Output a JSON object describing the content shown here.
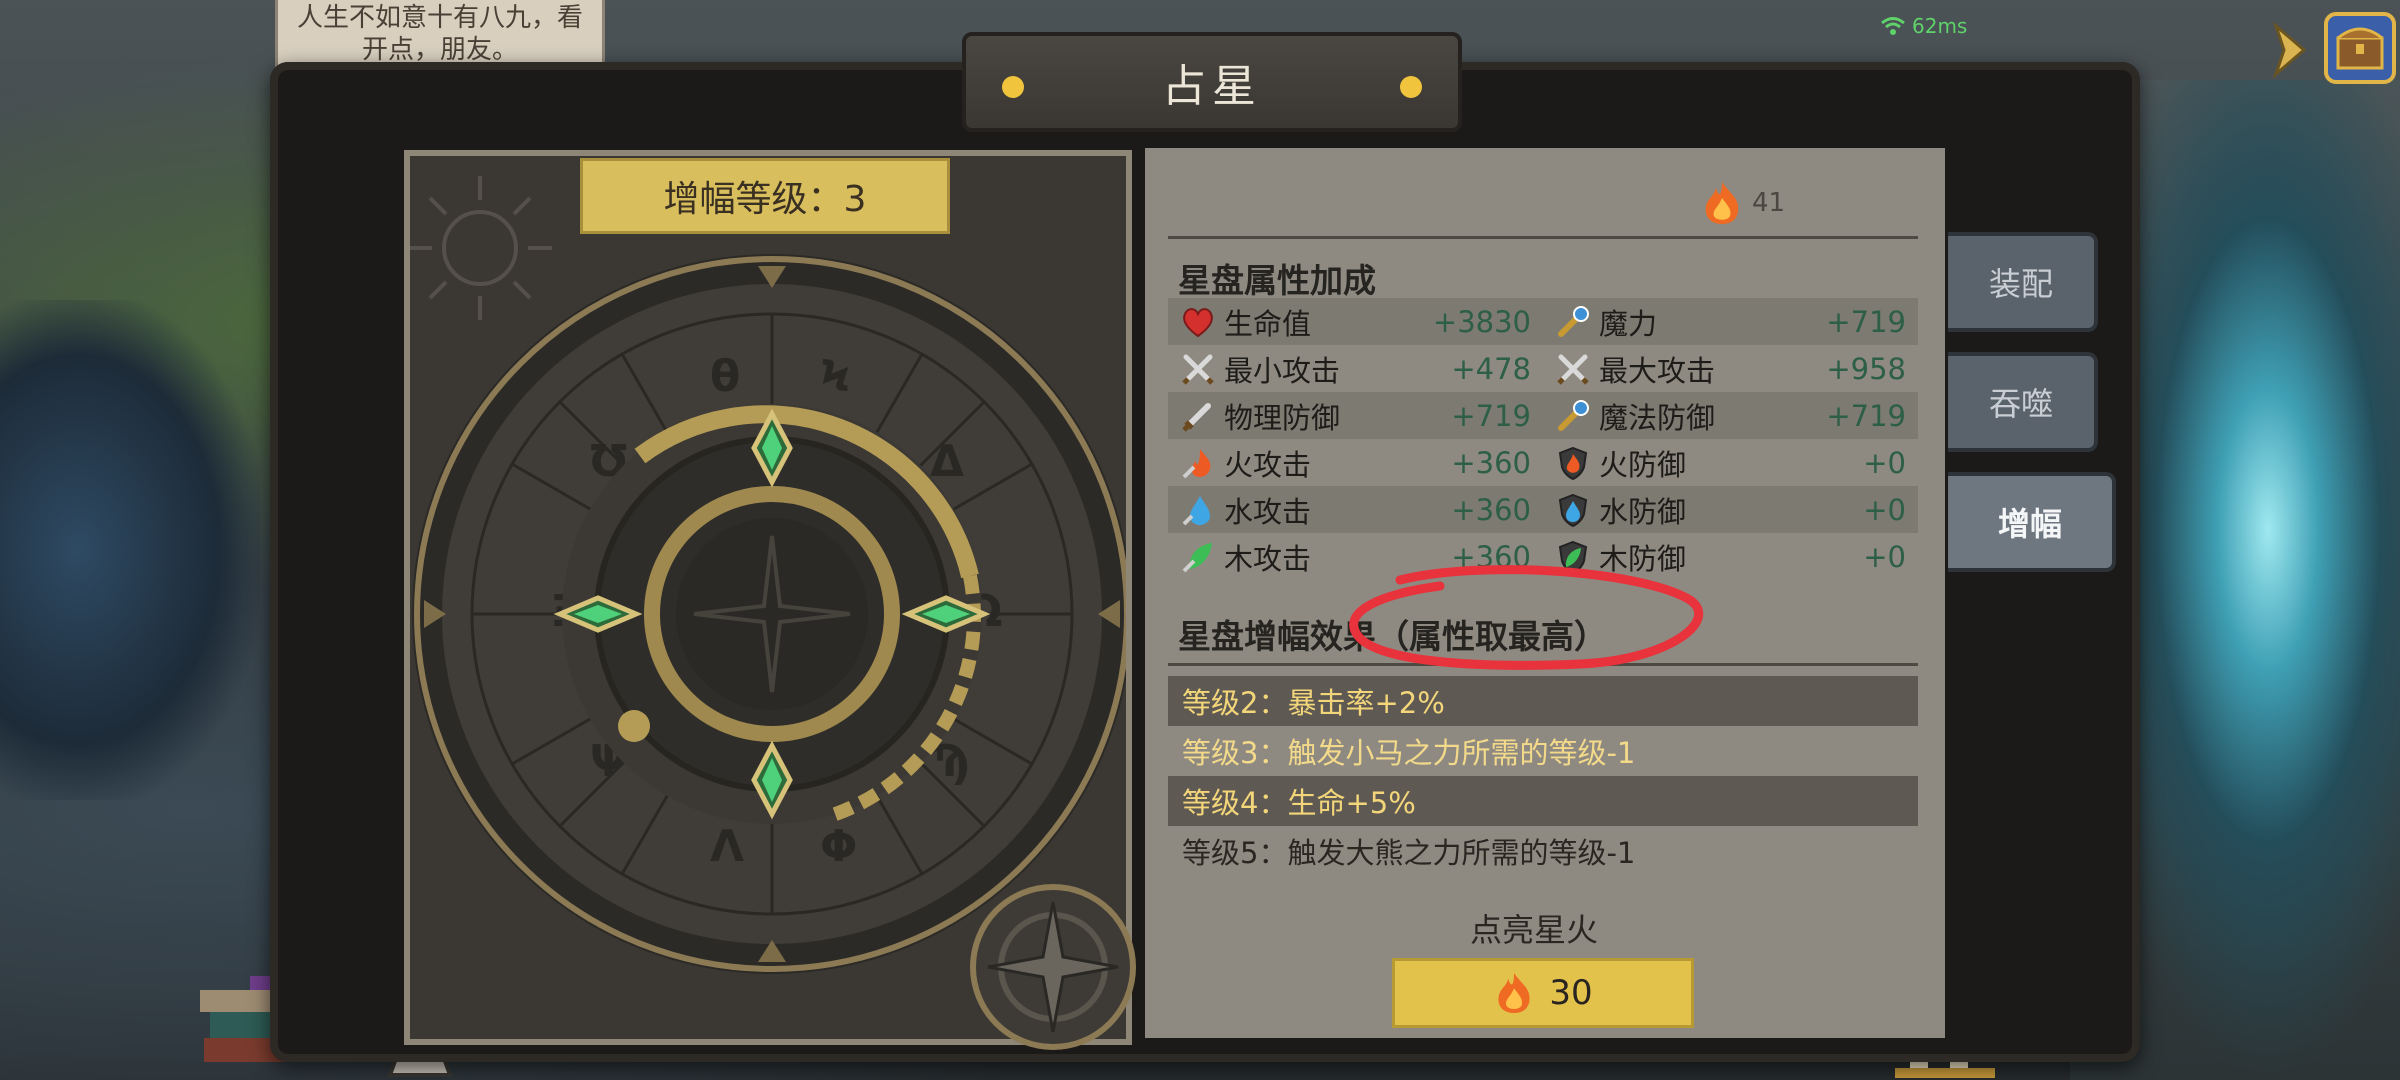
{
  "background": {
    "quote_line1": "人生不如意十有八九，看",
    "quote_line2": "开点，朋友。",
    "ping": "62ms"
  },
  "title": "占星",
  "dial": {
    "level_label": "增幅等级：3"
  },
  "flame_currency": {
    "icon": "flame-icon",
    "count": "41"
  },
  "attributes": {
    "title": "星盘属性加成",
    "rows": [
      [
        {
          "icon": "heart-icon",
          "name": "生命值",
          "value": "+3830"
        },
        {
          "icon": "wand-icon",
          "name": "魔力",
          "value": "+719"
        }
      ],
      [
        {
          "icon": "crossed-swords-icon",
          "name": "最小攻击",
          "value": "+478"
        },
        {
          "icon": "crossed-swords-icon",
          "name": "最大攻击",
          "value": "+958"
        }
      ],
      [
        {
          "icon": "sword-icon",
          "name": "物理防御",
          "value": "+719"
        },
        {
          "icon": "wand-icon",
          "name": "魔法防御",
          "value": "+719"
        }
      ],
      [
        {
          "icon": "fire-attack-icon",
          "name": "火攻击",
          "value": "+360"
        },
        {
          "icon": "fire-shield-icon",
          "name": "火防御",
          "value": "+0"
        }
      ],
      [
        {
          "icon": "water-attack-icon",
          "name": "水攻击",
          "value": "+360"
        },
        {
          "icon": "water-shield-icon",
          "name": "水防御",
          "value": "+0"
        }
      ],
      [
        {
          "icon": "wood-attack-icon",
          "name": "木攻击",
          "value": "+360"
        },
        {
          "icon": "wood-shield-icon",
          "name": "木防御",
          "value": "+0"
        }
      ]
    ]
  },
  "amplify_effects": {
    "title": "星盘增幅效果（属性取最高）",
    "items": [
      "等级2：暴击率+2%",
      "等级3：触发小马之力所需的等级-1",
      "等级4：生命+5%",
      "等级5：触发大熊之力所需的等级-1"
    ]
  },
  "light_up": {
    "label": "点亮星火",
    "cost": "30"
  },
  "side_tabs": [
    {
      "label": "装配",
      "active": false
    },
    {
      "label": "吞噬",
      "active": false
    },
    {
      "label": "增幅",
      "active": true
    }
  ],
  "colors": {
    "accent_gold": "#e3c24c",
    "stat_value_green": "#2d5e46",
    "gem_green": "#3fbf6a",
    "annotation_red": "#e8323c"
  }
}
